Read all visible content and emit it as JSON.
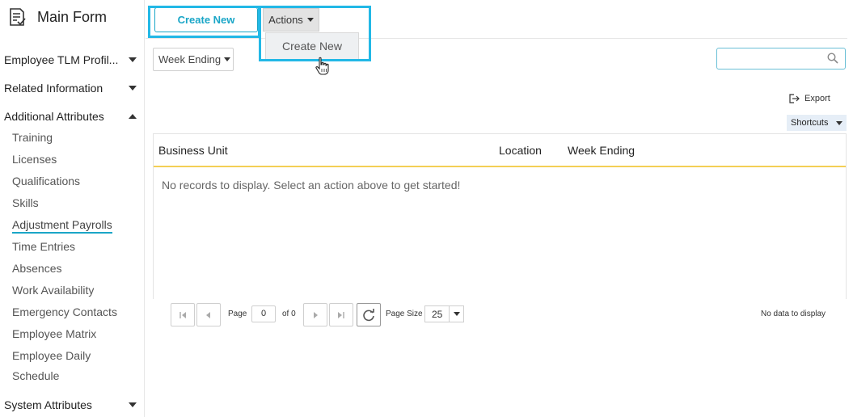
{
  "sidebar": {
    "title": "Main Form",
    "sections": [
      {
        "label": "Employee TLM Profil...",
        "state": "collapsed"
      },
      {
        "label": "Related Information",
        "state": "collapsed"
      },
      {
        "label": "Additional Attributes",
        "state": "expanded"
      },
      {
        "label": "System Attributes",
        "state": "collapsed"
      }
    ],
    "items": [
      "Training",
      "Licenses",
      "Qualifications",
      "Skills",
      "Adjustment Payrolls",
      "Time Entries",
      "Absences",
      "Work Availability",
      "Emergency Contacts",
      "Employee Matrix",
      "Employee Daily",
      "Schedule"
    ],
    "active_item": "Adjustment Payrolls"
  },
  "toolbar": {
    "create_label": "Create New",
    "actions_label": "Actions",
    "dropdown_items": [
      "Create New"
    ]
  },
  "filter": {
    "week_label": "Week Ending",
    "search_value": ""
  },
  "export_label": "Export",
  "shortcuts_label": "Shortcuts",
  "grid": {
    "columns": [
      "Business Unit",
      "Location",
      "Week Ending"
    ],
    "empty_message": "No records to display. Select an action above to get started!"
  },
  "pager": {
    "page_label": "Page",
    "page_value": "0",
    "of_label": "of 0",
    "size_label": "Page Size",
    "size_value": "25",
    "no_data": "No data to display"
  },
  "colors": {
    "accent": "#1aa6c7",
    "highlight": "#22b8e6",
    "grid_header_rule": "#f3cf55"
  }
}
